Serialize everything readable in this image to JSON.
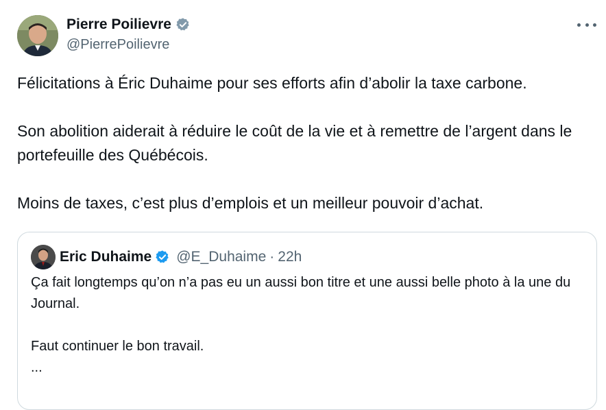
{
  "tweet": {
    "author_name": "Pierre Poilievre",
    "author_handle": "@PierrePoilievre",
    "paragraphs": [
      "Félicitations à Éric Duhaime pour ses efforts afin d’abolir la taxe carbone.",
      "Son abolition aiderait à réduire le coût de la vie et à remettre de l’argent dans le portefeuille des Québécois.",
      "Moins de taxes, c’est plus d’emplois et un meilleur pouvoir d’achat."
    ]
  },
  "quoted_tweet": {
    "author_name": "Eric Duhaime",
    "author_handle": "@E_Duhaime",
    "separator": "·",
    "time": "22h",
    "paragraphs": [
      "Ça fait longtemps qu’on n’a pas eu un aussi bon titre et une aussi belle photo à la une du Journal.",
      "Faut continuer le bon travail.",
      "..."
    ]
  },
  "colors": {
    "verified_blue": "#1d9bf0",
    "secondary_text": "#536471",
    "border": "#cfd9de"
  },
  "icons": {
    "verified": "verified-badge-icon",
    "more": "more-dots-icon"
  }
}
